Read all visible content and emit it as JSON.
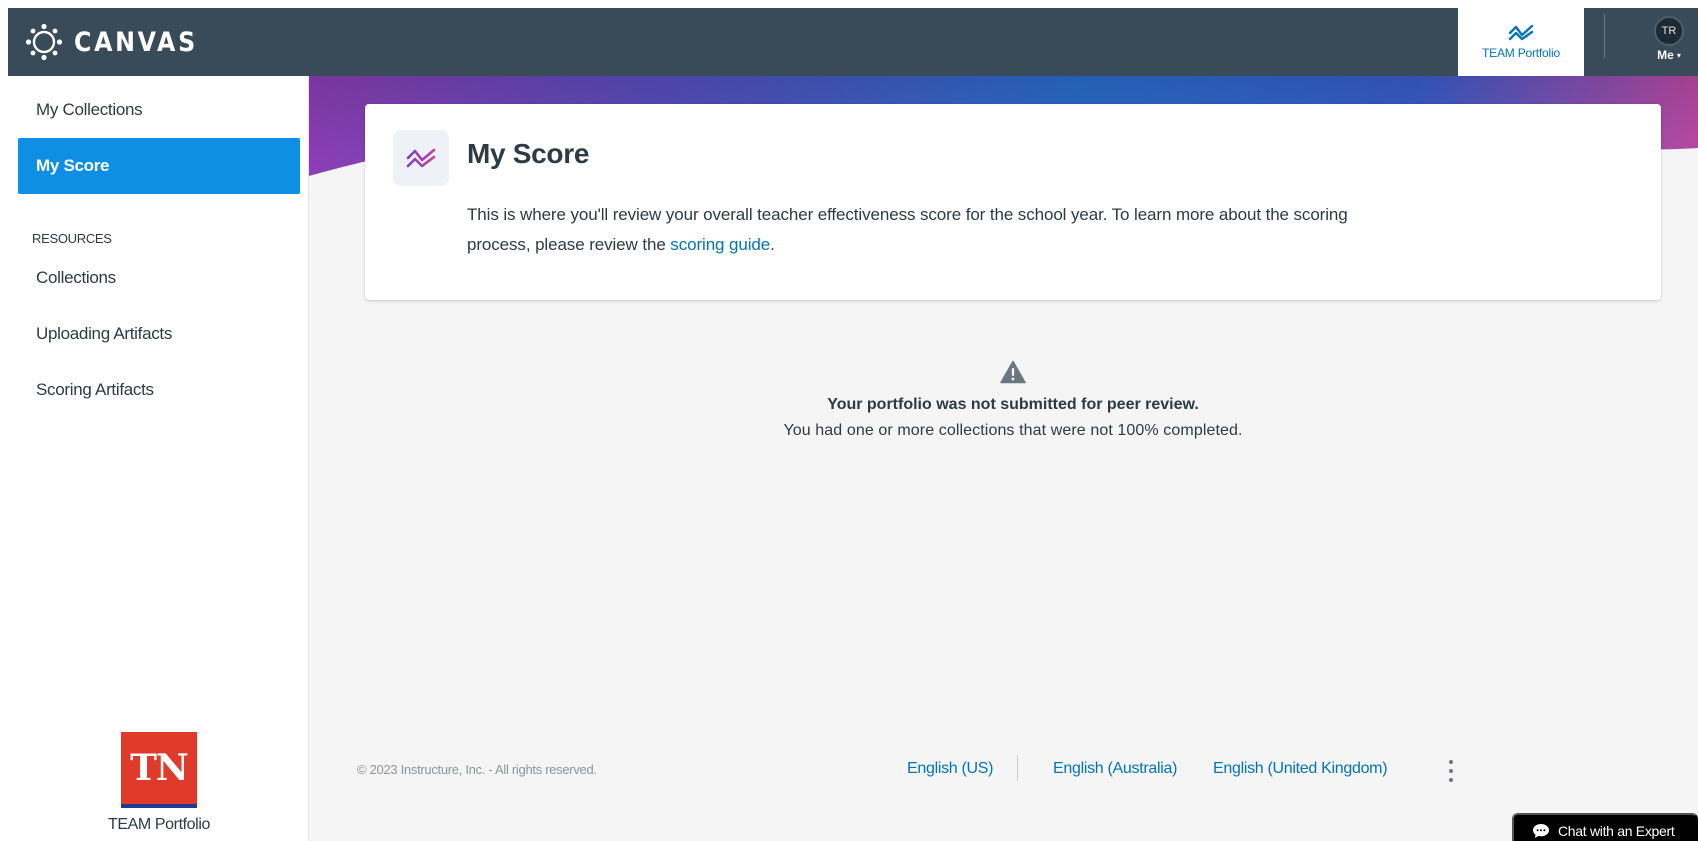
{
  "header": {
    "logo_text": "CANVAS",
    "app_tab_label": "TEAM Portfolio",
    "avatar_initials": "TR",
    "user_label": "Me"
  },
  "sidebar": {
    "items_top": [
      {
        "label": "My Collections",
        "active": false
      },
      {
        "label": "My Score",
        "active": true
      }
    ],
    "section_label": "RESOURCES",
    "items_resources": [
      {
        "label": "Collections"
      },
      {
        "label": "Uploading Artifacts"
      },
      {
        "label": "Scoring Artifacts"
      }
    ],
    "logo_text": "TN",
    "footer_label": "TEAM Portfolio"
  },
  "main": {
    "card": {
      "title": "My Score",
      "body_text": "This is where you'll review your overall teacher effectiveness score for the school year. To learn more about the scoring process, please review the ",
      "link_text": "scoring guide",
      "body_end": "."
    },
    "empty_state": {
      "title": "Your portfolio was not submitted for peer review.",
      "message": "You had one or more collections that were not 100% completed."
    }
  },
  "footer": {
    "copyright": "© 2023 Instructure, Inc. - All rights reserved.",
    "languages": [
      "English (US)",
      "English (Australia)",
      "English (United Kingdom)"
    ]
  },
  "chat": {
    "label": "Chat with an Expert"
  },
  "colors": {
    "topbar": "#394b58",
    "accent": "#0e8fe3",
    "link": "#0374b5",
    "tn_red": "#e03a2b"
  }
}
